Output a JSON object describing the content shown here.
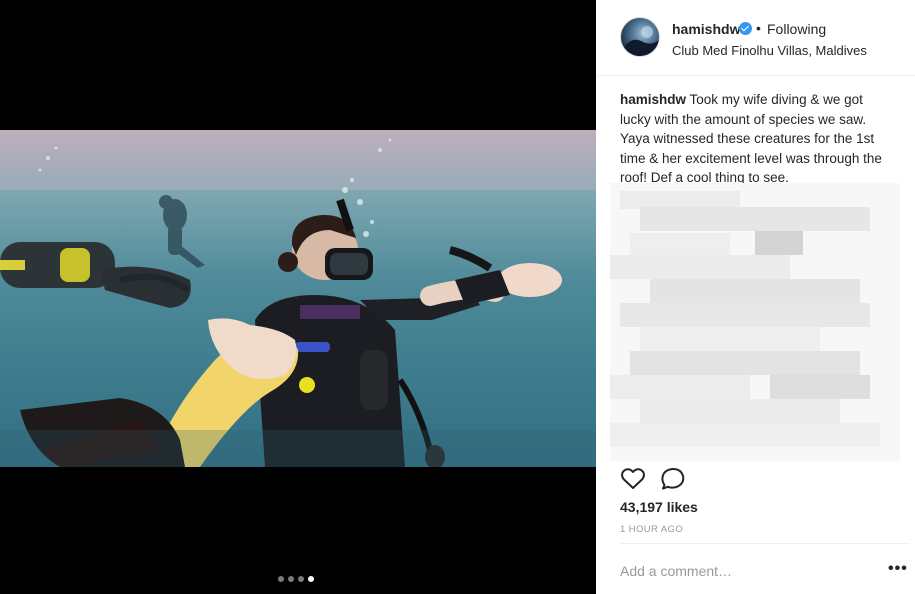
{
  "post": {
    "username": "hamishdw",
    "verified": true,
    "separator": "•",
    "follow_status": "Following",
    "location": "Club Med Finolhu Villas, Maldives",
    "caption_author": "hamishdw",
    "caption_text": "Took my wife diving & we got lucky with the amount of species we saw. Yaya witnessed these creatures for the 1st time & her excitement level was through the roof! Def a cool thing to see.",
    "likes": "43,197 likes",
    "timestamp": "1 HOUR AGO",
    "comment_placeholder": "Add a comment…",
    "more_options": "•••"
  },
  "carousel": {
    "count": 4,
    "active_index": 3
  },
  "icons": {
    "like": "heart-icon",
    "comment": "comment-bubble-icon",
    "verified": "verified-badge-icon",
    "more": "more-options-icon"
  },
  "colors": {
    "accent": "#3897f0",
    "text": "#262626",
    "muted": "#999999",
    "divider": "#efefef",
    "background": "#000000"
  }
}
